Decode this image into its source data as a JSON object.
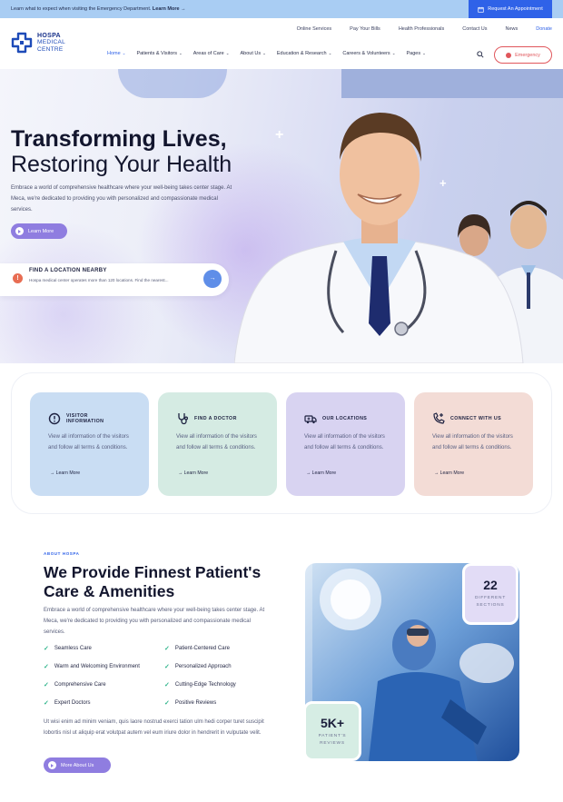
{
  "topbar": {
    "message": "Learn what to expect when visiting the Emergency Department.",
    "message_link": "Learn More →",
    "appointment_label": "Request An Appointment"
  },
  "logo": {
    "line1": "HOSPA",
    "line2": "MEDICAL",
    "line3": "CENTRE"
  },
  "utility_nav": [
    "Online Services",
    "Pay Your Bills",
    "Health Professionals",
    "Contact Us",
    "News",
    "Donate"
  ],
  "main_nav": [
    {
      "label": "Home",
      "active": true
    },
    {
      "label": "Patients & Visitors"
    },
    {
      "label": "Areas of Care"
    },
    {
      "label": "About Us"
    },
    {
      "label": "Education & Research"
    },
    {
      "label": "Careers & Volunteers"
    },
    {
      "label": "Pages"
    }
  ],
  "emergency_label": "Emergency",
  "hero": {
    "title_line1": "Transforming Lives,",
    "title_line2": "Restoring Your Health",
    "lead": "Embrace a world of comprehensive healthcare where your well-being takes center stage. At Meca, we're dedicated to providing you with personalized and compassionate medical services.",
    "button_label": "Learn More",
    "location_title": "FIND A LOCATION NEARBY",
    "location_desc": "Hospa medical center operates more than 120 locations. Find the nearest..."
  },
  "cards": [
    {
      "title_line1": "VISITOR",
      "title_line2": "INFORMATION",
      "desc": "View all information of the visitors and follow all terms & conditions.",
      "link": "Learn More",
      "color": "#c9ddf3",
      "icon": "alert-circle-icon"
    },
    {
      "title_line1": "FIND A DOCTOR",
      "title_line2": "",
      "desc": "View all information of the visitors and follow all terms & conditions.",
      "link": "Learn More",
      "color": "#d5ebe3",
      "icon": "stethoscope-icon"
    },
    {
      "title_line1": "OUR LOCATIONS",
      "title_line2": "",
      "desc": "View all information of the visitors and follow all terms & conditions.",
      "link": "Learn More",
      "color": "#d8d3f1",
      "icon": "ambulance-icon"
    },
    {
      "title_line1": "CONNECT WITH US",
      "title_line2": "",
      "desc": "View all information of the visitors and follow all terms & conditions.",
      "link": "Learn More",
      "color": "#f3dcd6",
      "icon": "phone-plus-icon"
    }
  ],
  "about": {
    "tag": "ABOUT HOSPA",
    "heading_line1": "We Provide Finnest Patient's",
    "heading_line2": "Care & Amenities",
    "paragraph": "Embrace a world of comprehensive healthcare where your well-being takes center stage. At Meca, we're dedicated to providing you with personalized and compassionate medical services.",
    "checklist": [
      "Seamless Care",
      "Patient-Centered Care",
      "Warm and Welcoming Environment",
      "Personalized Approach",
      "Comprehensive Care",
      "Cutting-Edge Technology",
      "Expert Doctors",
      "Positive Reviews"
    ],
    "paragraph2": "Ut wisi enim ad minim veniam, quis laore nostrud exerci tation ulm hedi corper turet suscipit lobortis nisl ut aliquip erat volutpat autem vel eum iriure dolor in hendrerit in vulputate velit.",
    "button_label": "More About Us"
  },
  "stats": {
    "sections_value": "22",
    "sections_label_line1": "DIFFERENT",
    "sections_label_line2": "SECTIONS",
    "reviews_value": "5K+",
    "reviews_label_line1": "PATIENT'S",
    "reviews_label_line2": "REVIEWS"
  },
  "colors": {
    "accent": "#2f62e8",
    "button": "#8f7de0",
    "emergency": "#e0565b",
    "check": "#31b58c"
  }
}
